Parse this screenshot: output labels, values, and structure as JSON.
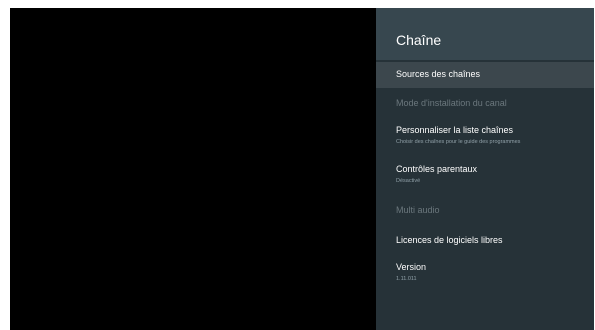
{
  "panel": {
    "title": "Chaîne",
    "items": [
      {
        "label": "Sources des chaînes",
        "subtitle": ""
      },
      {
        "label": "Mode d'installation du canal",
        "subtitle": ""
      },
      {
        "label": "Personnaliser la liste chaînes",
        "subtitle": "Choisir des chaînes pour le guide des programmes"
      },
      {
        "label": "Contrôles parentaux",
        "subtitle": "Désactivé"
      },
      {
        "label": "Multi audio",
        "subtitle": ""
      },
      {
        "label": "Licences de logiciels libres",
        "subtitle": ""
      },
      {
        "label": "Version",
        "subtitle": "1.11.011"
      }
    ]
  },
  "colors": {
    "panel_bg": "#263238",
    "header_bg": "#37474f",
    "selected_bg": "#3c474d",
    "disabled_text": "#6b777d"
  }
}
